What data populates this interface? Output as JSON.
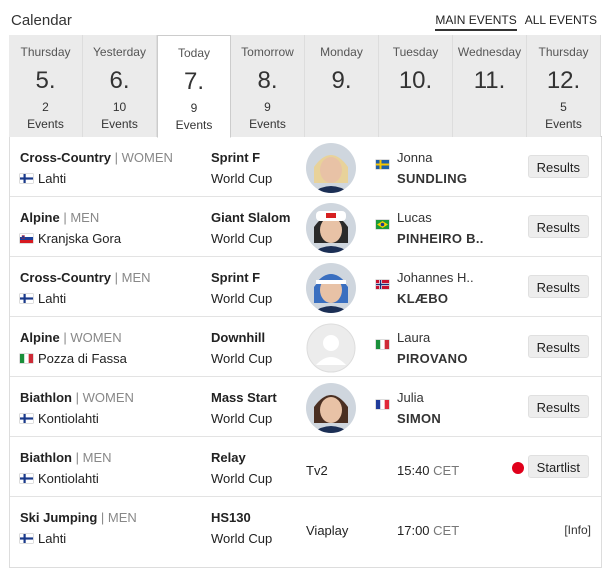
{
  "header": {
    "title": "Calendar",
    "filters": [
      "MAIN EVENTS",
      "ALL EVENTS"
    ],
    "active_filter": "MAIN EVENTS"
  },
  "days": [
    {
      "name": "Thursday",
      "num": "5.",
      "count": "2",
      "label": "Events"
    },
    {
      "name": "Yesterday",
      "num": "6.",
      "count": "10",
      "label": "Events"
    },
    {
      "name": "Today",
      "num": "7.",
      "count": "9",
      "label": "Events",
      "selected": true
    },
    {
      "name": "Tomorrow",
      "num": "8.",
      "count": "9",
      "label": "Events"
    },
    {
      "name": "Monday",
      "num": "9.",
      "count": "",
      "label": ""
    },
    {
      "name": "Tuesday",
      "num": "10.",
      "count": "",
      "label": ""
    },
    {
      "name": "Wednesday",
      "num": "11.",
      "count": "",
      "label": ""
    },
    {
      "name": "Thursday",
      "num": "12.",
      "count": "5",
      "label": "Events"
    }
  ],
  "events": [
    {
      "discipline": "Cross-Country",
      "gender": "WOMEN",
      "place": "Lahti",
      "place_flag": "finland",
      "event": "Sprint F",
      "competition": "World Cup",
      "athlete_first": "Jonna",
      "athlete_last": "SUNDLING",
      "athlete_flag": "sweden",
      "photo": "athlete-blonde",
      "action": "Results"
    },
    {
      "discipline": "Alpine",
      "gender": "MEN",
      "place": "Kranjska Gora",
      "place_flag": "slovenia",
      "event": "Giant Slalom",
      "competition": "World Cup",
      "athlete_first": "Lucas",
      "athlete_last": "PINHEIRO B..",
      "athlete_flag": "brazil",
      "photo": "athlete-cap",
      "action": "Results"
    },
    {
      "discipline": "Cross-Country",
      "gender": "MEN",
      "place": "Lahti",
      "place_flag": "finland",
      "event": "Sprint F",
      "competition": "World Cup",
      "athlete_first": "Johannes H..",
      "athlete_last": "KLÆBO",
      "athlete_flag": "norway",
      "photo": "athlete-hat",
      "action": "Results"
    },
    {
      "discipline": "Alpine",
      "gender": "WOMEN",
      "place": "Pozza di Fassa",
      "place_flag": "italy",
      "event": "Downhill",
      "competition": "World Cup",
      "athlete_first": "Laura",
      "athlete_last": "PIROVANO",
      "athlete_flag": "italy",
      "photo": "placeholder-avatar",
      "action": "Results"
    },
    {
      "discipline": "Biathlon",
      "gender": "WOMEN",
      "place": "Kontiolahti",
      "place_flag": "finland",
      "event": "Mass Start",
      "competition": "World Cup",
      "athlete_first": "Julia",
      "athlete_last": "SIMON",
      "athlete_flag": "france",
      "photo": "athlete-dark",
      "action": "Results"
    },
    {
      "discipline": "Biathlon",
      "gender": "MEN",
      "place": "Kontiolahti",
      "place_flag": "finland",
      "event": "Relay",
      "competition": "World Cup",
      "tv": "Tv2",
      "time": "15:40",
      "tz": "CET",
      "live": true,
      "action": "Startlist"
    },
    {
      "discipline": "Ski Jumping",
      "gender": "MEN",
      "place": "Lahti",
      "place_flag": "finland",
      "event": "HS130",
      "competition": "World Cup",
      "tv": "Viaplay",
      "time": "17:00",
      "tz": "CET",
      "info": "[Info]"
    }
  ],
  "colors": {
    "live_dot": "#e0001b",
    "tab_bg": "#ebebeb",
    "button_bg": "#ededed"
  }
}
